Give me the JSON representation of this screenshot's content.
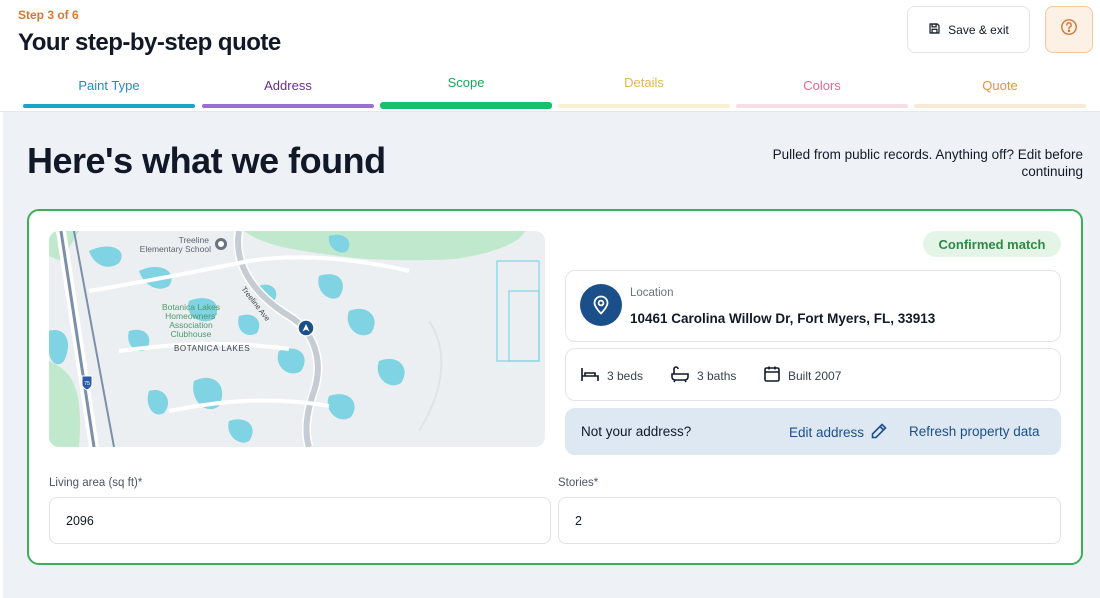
{
  "header": {
    "step_label": "Step 3 of 6",
    "title": "Your step-by-step quote",
    "save_label": "Save & exit",
    "help_icon": "question-circle-icon"
  },
  "steps": [
    {
      "label": "Paint Type",
      "color": "#1a93b8",
      "bar": "#1aa4c8"
    },
    {
      "label": "Address",
      "color": "#6b2d8f",
      "bar": "#9b6fd1"
    },
    {
      "label": "Scope",
      "color": "#17a85e",
      "bar": "#17c06b"
    },
    {
      "label": "Details",
      "color": "#e2b84a",
      "bar": "#f8f0cf"
    },
    {
      "label": "Colors",
      "color": "#e06a8b",
      "bar": "#f8dde5"
    },
    {
      "label": "Quote",
      "color": "#e0963a",
      "bar": "#f8ead7"
    }
  ],
  "main": {
    "title": "Here's what we found",
    "note": "Pulled from public records. Anything off? Edit before continuing"
  },
  "map": {
    "labels": {
      "school_line1": "Treeline",
      "school_line2": "Elementary School",
      "street": "Treeline Ave",
      "hoa_line1": "Botanica Lakes",
      "hoa_line2": "Homeowners'",
      "hoa_line3": "Association",
      "hoa_line4": "Clubhouse",
      "area": "BOTANICA LAKES",
      "highway": "75"
    }
  },
  "property": {
    "badge": "Confirmed match",
    "location_label": "Location",
    "location_value": "10461 Carolina Willow Dr, Fort Myers, FL, 33913",
    "beds": "3 beds",
    "baths": "3 baths",
    "built": "Built 2007",
    "not_your_address": "Not your address?",
    "edit_address": "Edit address",
    "refresh": "Refresh property data"
  },
  "fields": {
    "living_area_label": "Living area (sq ft)*",
    "living_area_value": "2096",
    "stories_label": "Stories*",
    "stories_value": "2"
  },
  "colors": {
    "accent": "#d9772f",
    "success": "#3cae5a",
    "link": "#1b4f8a"
  }
}
